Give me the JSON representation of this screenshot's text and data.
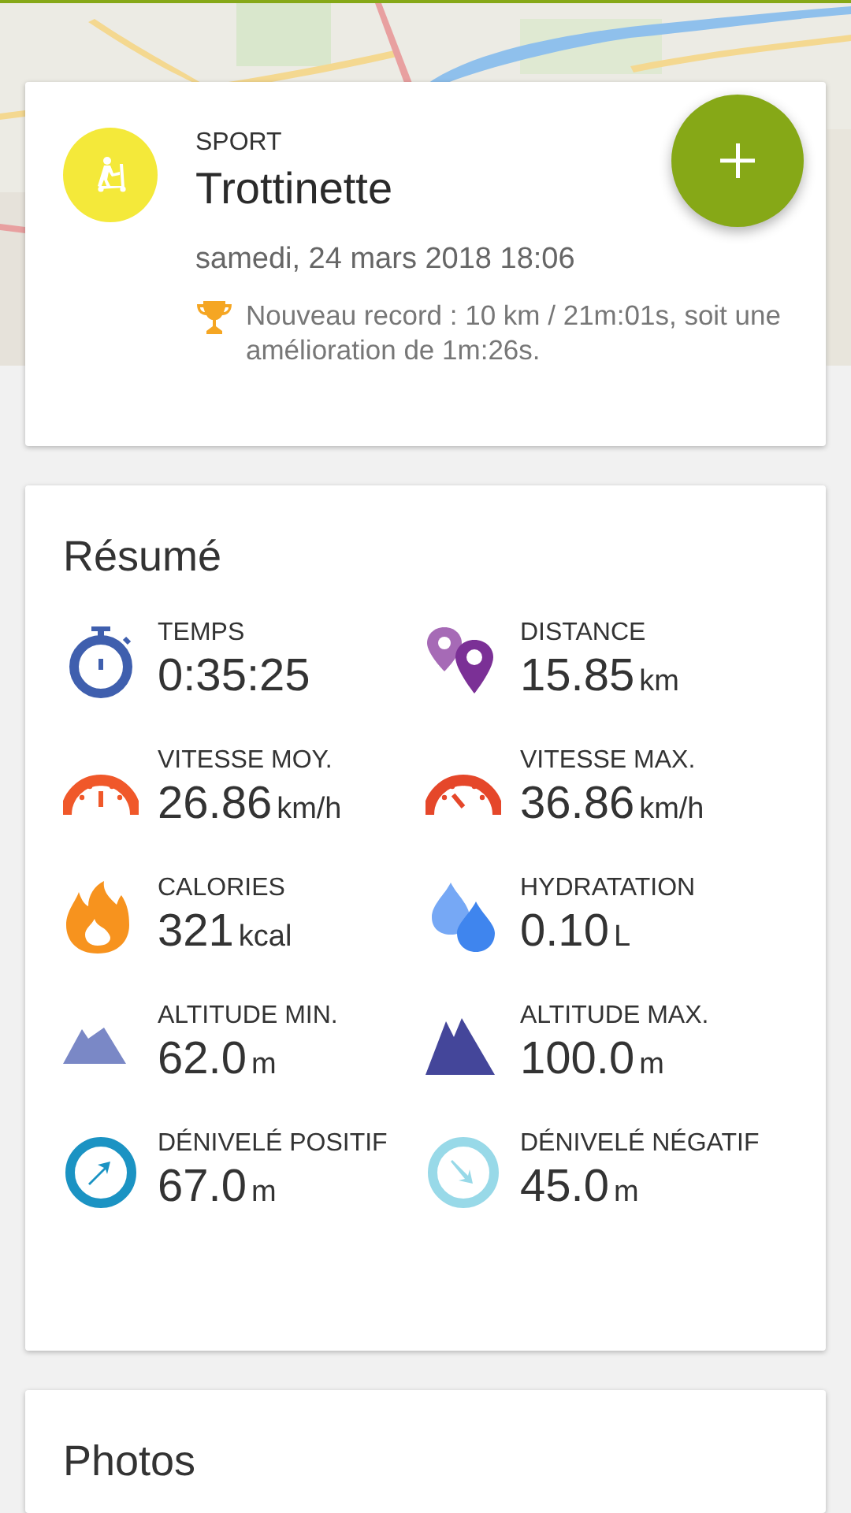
{
  "header": {
    "sport_label": "SPORT",
    "sport": "Trottinette",
    "date": "samedi, 24 mars 2018 18:06",
    "record": "Nouveau record : 10 km / 21m:01s, soit une amélioration de 1m:26s."
  },
  "summary": {
    "title": "Résumé",
    "stats": [
      {
        "kind": "timer",
        "label": "TEMPS",
        "value": "0:35:25"
      },
      {
        "kind": "distance",
        "label": "DISTANCE",
        "value": "15.85",
        "unit": "km"
      },
      {
        "kind": "speed-avg",
        "label": "VITESSE MOY.",
        "value": "26.86",
        "unit": "km/h"
      },
      {
        "kind": "speed-max",
        "label": "VITESSE MAX.",
        "value": "36.86",
        "unit": "km/h"
      },
      {
        "kind": "calories",
        "label": "CALORIES",
        "value": "321",
        "unit": "kcal"
      },
      {
        "kind": "hydration",
        "label": "HYDRATATION",
        "value": "0.10",
        "unit": "L"
      },
      {
        "kind": "alt-min",
        "label": "ALTITUDE MIN.",
        "value": "62.0",
        "unit": "m"
      },
      {
        "kind": "alt-max",
        "label": "ALTITUDE MAX.",
        "value": "100.0",
        "unit": "m"
      },
      {
        "kind": "climb-up",
        "label": "DÉNIVELÉ POSITIF",
        "value": "67.0",
        "unit": "m"
      },
      {
        "kind": "climb-down",
        "label": "DÉNIVELÉ NÉGATIF",
        "value": "45.0",
        "unit": "m"
      }
    ]
  },
  "photos": {
    "title": "Photos"
  }
}
